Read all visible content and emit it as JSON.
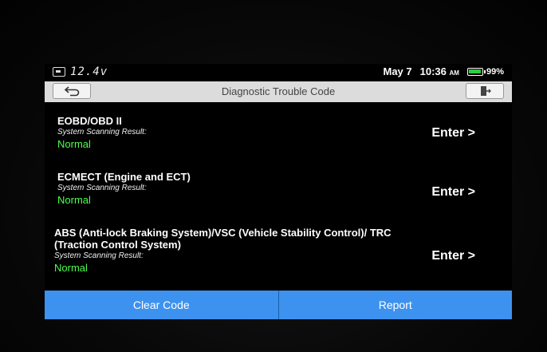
{
  "status_bar": {
    "voltage": "12.4v",
    "date": "May 7",
    "time": "10:36",
    "ampm": "AM",
    "battery_percent": "99%",
    "battery_level": 0.99
  },
  "header": {
    "title": "Diagnostic Trouble Code",
    "back_icon": "back-arrow-icon",
    "exit_icon": "exit-door-icon"
  },
  "systems": [
    {
      "name": "EOBD/OBD II",
      "result_label": "System Scanning Result:",
      "status": "Normal",
      "action": "Enter >"
    },
    {
      "name": "ECMECT (Engine and ECT)",
      "result_label": "System Scanning Result:",
      "status": "Normal",
      "action": "Enter >"
    },
    {
      "name": "ABS (Anti-lock Braking System)/VSC (Vehicle Stability Control)/ TRC (Traction Control System)",
      "result_label": "System Scanning Result:",
      "status": "Normal",
      "action": "Enter >"
    }
  ],
  "footer": {
    "clear_label": "Clear Code",
    "report_label": "Report"
  },
  "colors": {
    "accent": "#3d92ef",
    "status_normal": "#4cff4c",
    "title_bar": "#dcdcdc"
  }
}
